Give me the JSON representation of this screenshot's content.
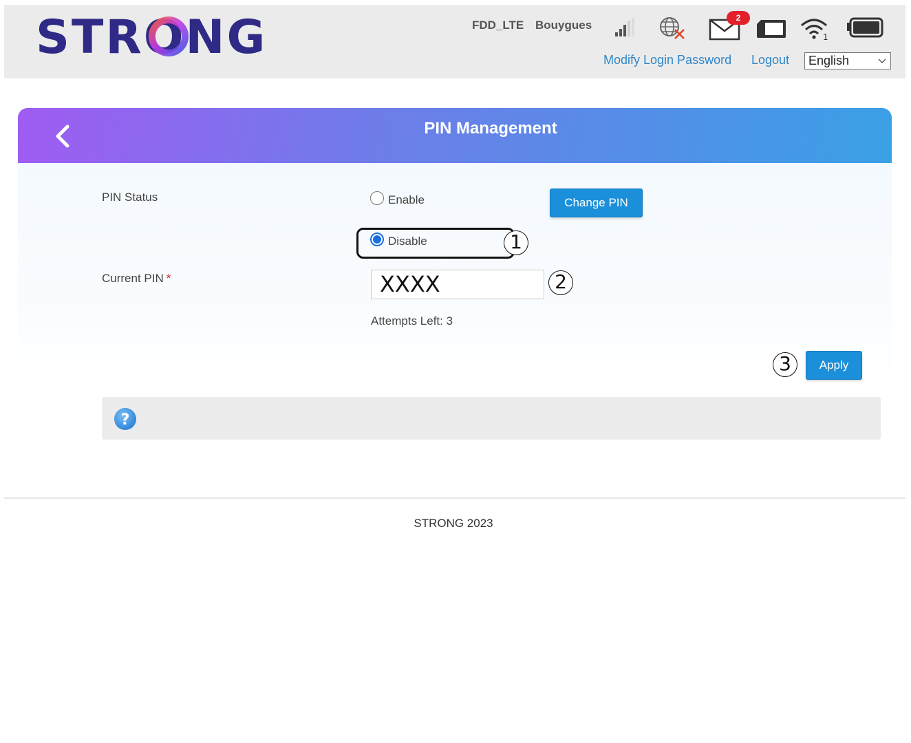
{
  "brand": {
    "logo_text": "STRONG"
  },
  "header": {
    "network_type": "FDD_LTE",
    "operator": "Bouygues",
    "unread_messages": "2",
    "modify_password_link": "Modify Login Password",
    "logout_link": "Logout",
    "language_selected": "English",
    "icons": [
      "signal-icon",
      "globe-disconnected-icon",
      "mail-icon",
      "sim-card-icon",
      "wifi-icon",
      "battery-icon"
    ]
  },
  "page": {
    "title": "PIN Management",
    "pin_status_label": "PIN Status",
    "enable_option": "Enable",
    "disable_option": "Disable",
    "selected_option": "Disable",
    "change_pin_button": "Change PIN",
    "current_pin_label": "Current PIN",
    "required_marker": "*",
    "current_pin_value": "XXXX",
    "attempts_left": "Attempts Left: 3",
    "apply_button": "Apply"
  },
  "callouts": [
    "1",
    "2",
    "3"
  ],
  "footer": {
    "text": "STRONG 2023"
  },
  "colors": {
    "accent_blue": "#1b8fd9",
    "header_gradient_start": "#a05cf2",
    "header_gradient_end": "#3aa0e6",
    "link": "#2e86c8",
    "badge": "#e4202a",
    "logo": "#2e2a86"
  }
}
